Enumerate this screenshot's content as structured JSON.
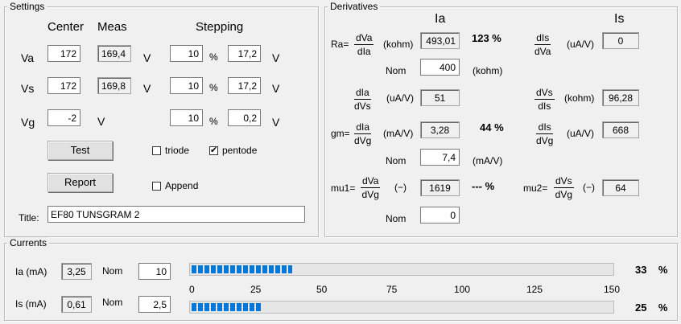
{
  "settings": {
    "legend": "Settings",
    "col_center": "Center",
    "col_meas": "Meas",
    "col_stepping": "Stepping",
    "rows": [
      {
        "label": "Va",
        "center": "172",
        "meas": "169,4",
        "unit": "V",
        "step1": "10",
        "step1_unit": "%",
        "step2": "17,2",
        "step2_unit": "V"
      },
      {
        "label": "Vs",
        "center": "172",
        "meas": "169,8",
        "unit": "V",
        "step1": "10",
        "step1_unit": "%",
        "step2": "17,2",
        "step2_unit": "V"
      },
      {
        "label": "Vg",
        "center": "-2",
        "meas": "",
        "unit": "V",
        "step1": "10",
        "step1_unit": "%",
        "step2": "0,2",
        "step2_unit": "V"
      }
    ],
    "test_button": "Test",
    "report_button": "Report",
    "triode_label": "triode",
    "triode_checked": false,
    "pentode_label": "pentode",
    "pentode_checked": true,
    "append_label": "Append",
    "append_checked": false,
    "title_label": "Title:",
    "title_value": "EF80 TUNSGRAM 2"
  },
  "derivatives": {
    "legend": "Derivatives",
    "col_ia": "Ia",
    "col_is": "Is",
    "ra_label": "Ra=",
    "ra_frac": {
      "num": "dVa",
      "den": "dIa"
    },
    "ra_unit": "(kohm)",
    "ra_value": "493,01",
    "ra_pct": "123  %",
    "ra_nom_label": "Nom",
    "ra_nom_value": "400",
    "ra_nom_unit": "(kohm)",
    "dis_dva_frac": {
      "num": "dIs",
      "den": "dVa"
    },
    "dis_dva_unit": "(uA/V)",
    "dis_dva_value": "0",
    "dia_dvs_frac": {
      "num": "dIa",
      "den": "dVs"
    },
    "dia_dvs_unit": "(uA/V)",
    "dia_dvs_value": "51",
    "dvs_dis_frac": {
      "num": "dVs",
      "den": "dIs"
    },
    "dvs_dis_unit": "(kohm)",
    "dvs_dis_value": "96,28",
    "gm_label": "gm=",
    "gm_frac": {
      "num": "dIa",
      "den": "dVg"
    },
    "gm_unit": "(mA/V)",
    "gm_value": "3,28",
    "gm_pct": "44  %",
    "gm_nom_label": "Nom",
    "gm_nom_value": "7,4",
    "gm_nom_unit": "(mA/V)",
    "dis_dvg_frac": {
      "num": "dIs",
      "den": "dVg"
    },
    "dis_dvg_unit": "(uA/V)",
    "dis_dvg_value": "668",
    "mu1_label": "mu1=",
    "mu1_frac": {
      "num": "dVa",
      "den": "dVg"
    },
    "mu1_unit": "(−)",
    "mu1_value": "1619",
    "mu1_pct": "---  %",
    "mu1_nom_label": "Nom",
    "mu1_nom_value": "0",
    "mu2_label": "mu2=",
    "mu2_frac": {
      "num": "dVs",
      "den": "dVg"
    },
    "mu2_unit": "(−)",
    "mu2_value": "64"
  },
  "currents": {
    "legend": "Currents",
    "ia_label": "Ia (mA)",
    "ia_value": "3,25",
    "ia_nom_label": "Nom",
    "ia_nom_value": "10",
    "ia_pct": "33    %",
    "ia_progress": 0.24,
    "is_label": "Is (mA)",
    "is_value": "0,61",
    "is_nom_label": "Nom",
    "is_nom_value": "2,5",
    "is_pct": "25    %",
    "is_progress": 0.165,
    "scale": [
      "0",
      "25",
      "50",
      "75",
      "100",
      "125",
      "150"
    ]
  },
  "colors": {
    "progress_fill": "#0078d7",
    "background": "#f0f0f0"
  }
}
